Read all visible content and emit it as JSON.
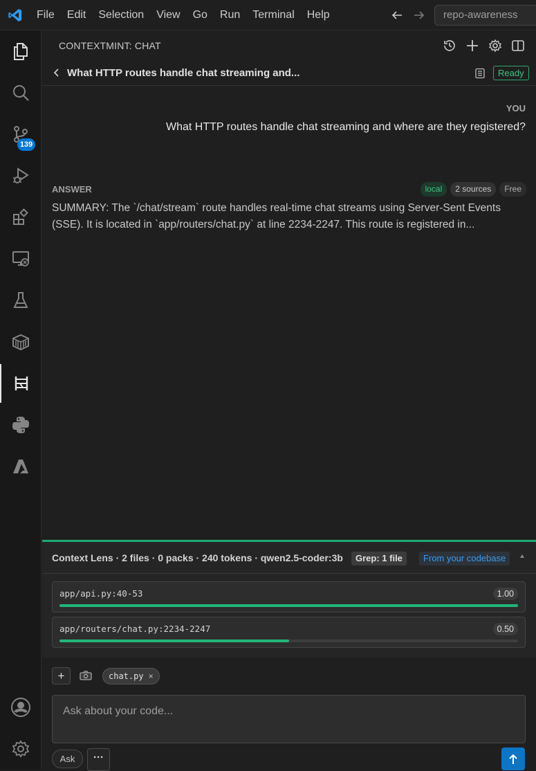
{
  "menu": [
    "File",
    "Edit",
    "Selection",
    "View",
    "Go",
    "Run",
    "Terminal",
    "Help"
  ],
  "search": {
    "text": "repo-awareness"
  },
  "activity_bar": {
    "source_control_badge": "139",
    "items": [
      "explorer-icon",
      "search-icon",
      "source-control-icon",
      "run-debug-icon",
      "extensions-icon",
      "remote-explorer-icon",
      "testing-icon",
      "containers-icon",
      "contextmint-icon",
      "python-icon",
      "azure-icon",
      "accounts-icon",
      "manage-gear-icon"
    ]
  },
  "panel": {
    "title": "CONTEXTMINT: CHAT",
    "conversation_title": "What HTTP routes handle chat streaming and...",
    "status": "Ready"
  },
  "chat": {
    "user_label": "YOU",
    "user_message": "What HTTP routes handle chat streaming and where are they registered?",
    "answer_label": "ANSWER",
    "tags": [
      "local",
      "2 sources",
      "Free"
    ],
    "answer_text": "SUMMARY: The `/chat/stream` route handles real-time chat streams using Server-Sent Events (SSE). It is located in `app/routers/chat.py` at line 2234-2247. This route is registered in..."
  },
  "context_lens": {
    "title": "Context Lens · 2 files · 0 packs · 240 tokens · qwen2.5-coder:3b",
    "grep": "Grep: 1 file",
    "source": "From your codebase",
    "files": [
      {
        "path": "app/api.py:40-53",
        "score": "1.00",
        "relevance": 1.0
      },
      {
        "path": "app/routers/chat.py:2234-2247",
        "score": "0.50",
        "relevance": 0.5
      }
    ]
  },
  "composer": {
    "attached_file": "chat.py",
    "placeholder": "Ask about your code...",
    "mode": "Ask",
    "more": "···"
  },
  "colors": {
    "accent_green": "#23b57a",
    "accent_blue": "#0e74c4",
    "badge_blue": "#0078d4"
  }
}
